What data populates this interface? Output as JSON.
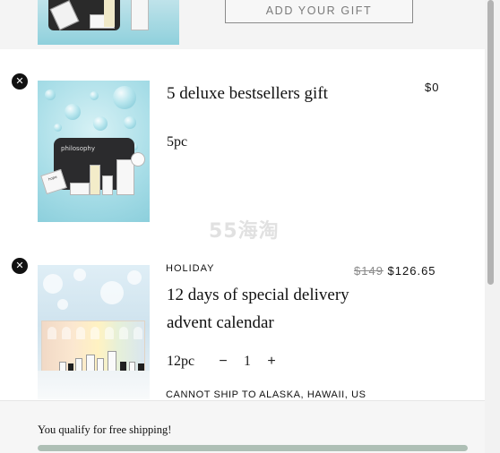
{
  "top": {
    "add_gift_label": "ADD YOUR GIFT"
  },
  "items": [
    {
      "remove_icon": "close-icon",
      "category": "",
      "title_line1": "5 deluxe bestsellers gift",
      "title_line2": "",
      "price": "$0",
      "piece_count": "5pc"
    },
    {
      "remove_icon": "close-icon",
      "category": "HOLIDAY",
      "title_line1": "12 days of special delivery",
      "title_line2": "advent calendar",
      "price_original": "$149",
      "price_sale": "$126.65",
      "piece_count": "12pc",
      "quantity": "1",
      "decrement_label": "−",
      "increment_label": "+",
      "shipping_note": "CANNOT SHIP TO ALASKA, HAWAII, US"
    }
  ],
  "watermark": "55海淘",
  "footer": {
    "free_shipping_text": "You qualify for free shipping!",
    "progress_fraction": 1.0,
    "progress_color": "#aebfb5"
  },
  "colors": {
    "remove_button": "#111111",
    "scroll_thumb": "#b3b3b3"
  }
}
